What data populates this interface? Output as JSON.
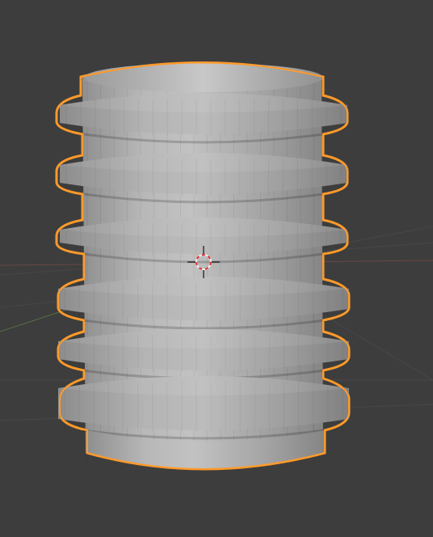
{
  "viewport": {
    "background": "#3d3d3d",
    "grid_color": "#4a4a4a",
    "axis_x_color": "#6b4a4a",
    "axis_y_color": "#55704a"
  },
  "object": {
    "name": "Cylinder",
    "selected": true,
    "outline_color": "#ff9a2a",
    "face_light": "#c4c4c4",
    "face_mid": "#a9a9a9",
    "face_dark": "#8a8a8a",
    "ring_count": 6
  },
  "cursor_3d": {
    "icon": "3d-cursor-icon",
    "ring_red": "#e03030",
    "ring_white": "#f0f0f0"
  }
}
